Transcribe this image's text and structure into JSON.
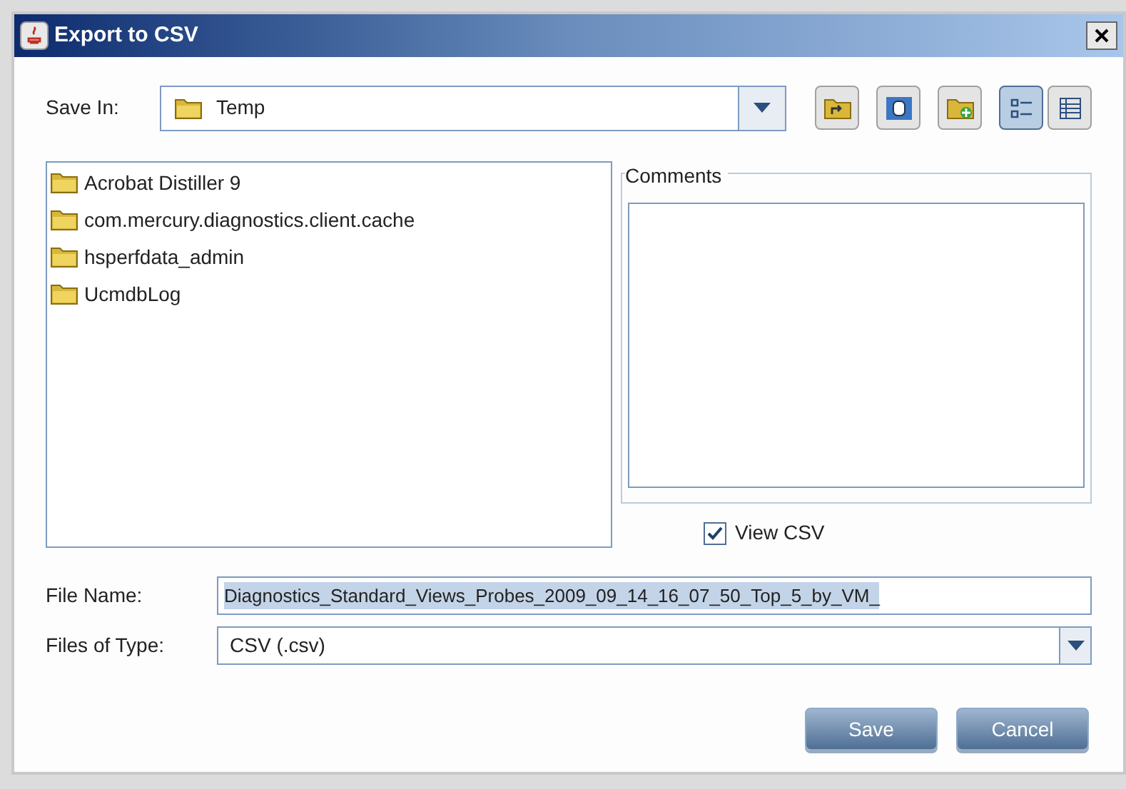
{
  "window": {
    "title": "Export to CSV"
  },
  "save_in": {
    "label": "Save In:",
    "value": "Temp"
  },
  "view_buttons": [
    {
      "selected": true
    },
    {
      "selected": false
    }
  ],
  "files": [
    {
      "name": "Acrobat Distiller 9"
    },
    {
      "name": "com.mercury.diagnostics.client.cache"
    },
    {
      "name": "hsperfdata_admin"
    },
    {
      "name": "UcmdbLog"
    }
  ],
  "comments": {
    "label": "Comments"
  },
  "view_csv": {
    "label": "View CSV",
    "checked": true
  },
  "file_name": {
    "label": "File Name:",
    "value": "Diagnostics_Standard_Views_Probes_2009_09_14_16_07_50_Top_5_by_VM_",
    "selected": true
  },
  "file_type": {
    "label": "Files of Type:",
    "value": "CSV (.csv)"
  },
  "buttons": [
    "Save",
    "Cancel"
  ]
}
